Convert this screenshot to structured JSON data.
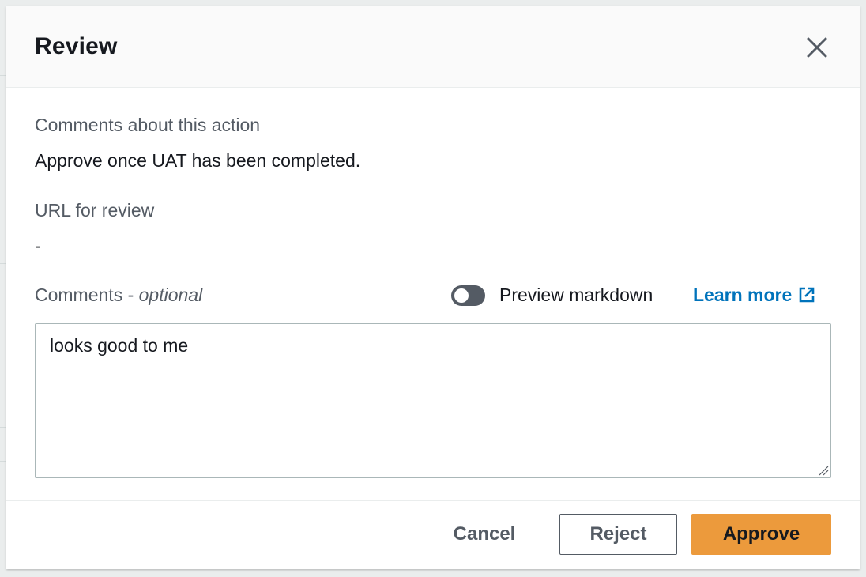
{
  "modal": {
    "title": "Review"
  },
  "fields": {
    "comments_about_action_label": "Comments about this action",
    "comments_about_action_value": "Approve once UAT has been completed.",
    "url_label": "URL for review",
    "url_value": "-",
    "comments_label": "Comments - ",
    "comments_optional": "optional",
    "comments_value": "looks good to me"
  },
  "preview": {
    "toggle_state": "off",
    "label": "Preview markdown"
  },
  "learn_more": {
    "label": "Learn more"
  },
  "footer": {
    "cancel_label": "Cancel",
    "reject_label": "Reject",
    "approve_label": "Approve"
  },
  "colors": {
    "approve_button": "#ec9a3c",
    "link": "#0073bb",
    "toggle_off": "#545b64"
  },
  "icons": {
    "close": "close-icon",
    "external_link": "external-link-icon",
    "resize": "resize-handle-icon"
  }
}
